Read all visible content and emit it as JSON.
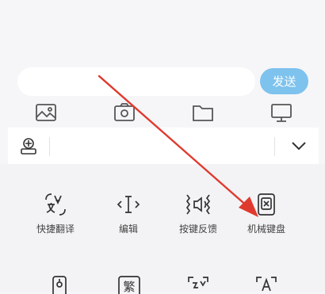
{
  "composer": {
    "input_value": "",
    "send_label": "发送"
  },
  "attachments": {
    "icons": [
      "image-icon",
      "camera-icon",
      "folder-icon",
      "monitor-icon"
    ]
  },
  "toolbar": {
    "keyboard_icon": "keyboard-settings-icon",
    "collapse_icon": "chevron-down-icon"
  },
  "tools": [
    {
      "label": "快捷翻译",
      "icon": "translate-icon"
    },
    {
      "label": "编辑",
      "icon": "cursor-edit-icon"
    },
    {
      "label": "按键反馈",
      "icon": "key-feedback-icon"
    },
    {
      "label": "机械键盘",
      "icon": "mechanical-keyboard-icon"
    }
  ],
  "tools_row2": {
    "icons": [
      "tool-icon-1",
      "traditional-char-icon",
      "scan-icon",
      "text-recognition-icon"
    ],
    "glyph_2": "繁"
  },
  "annotation": {
    "arrow_color": "#e03a2f"
  }
}
